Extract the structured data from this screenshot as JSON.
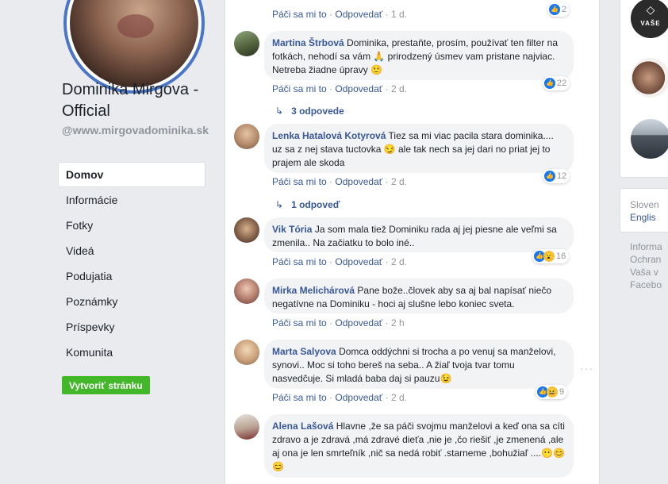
{
  "page": {
    "name": "Dominika Mirgova - Official",
    "handle": "@www.mirgovadominika.sk"
  },
  "nav": {
    "items": [
      "Domov",
      "Informácie",
      "Fotky",
      "Videá",
      "Podujatia",
      "Poznámky",
      "Príspevky",
      "Komunita"
    ],
    "create_button": "Vytvoriť stránku"
  },
  "labels": {
    "like": "Páči sa mi to",
    "reply": "Odpovedať",
    "dot": "·"
  },
  "top": {
    "time": "1 d.",
    "reactions": "2"
  },
  "comments": [
    {
      "author": "Martina Štrbová",
      "text": "Dominika, prestaňte, prosím, používať ten filter na fotkách, nehodí sa vám 🙏 prirodzený úsmev vam pristane najviac. Netreba žiadne úpravy 🙂",
      "time": "2 d.",
      "reactions": "22",
      "replies": "3 odpovede"
    },
    {
      "author": "Lenka Hatalová Kotyrová",
      "text": "Tiez sa mi viac pacila stara dominika.... uz sa z nej stava tuctovka 😏 ale tak nech sa jej dari no priat jej to prajem ale skoda",
      "time": "2 d.",
      "reactions": "12",
      "replies": "1 odpoveď"
    },
    {
      "author": "Vik Tória",
      "text": "Ja som mala tiež Dominiku rada aj jej piesne ale veľmi sa zmenila.. Na začiatku to bolo iné..",
      "time": "2 d.",
      "reactions": "16"
    },
    {
      "author": "Mirka Melichárová",
      "text": "Pane bože..človek aby sa aj bal napísať niečo negatívne na Dominiku - hoci aj slušne lebo koniec sveta.",
      "time": "2 h"
    },
    {
      "author": "Marta Salyova",
      "text": "Domca oddýchni si trocha a po venuj sa manželovi, synovi.. Moc si toho bereš na seba.. A žiaľ tvoja tvar tomu nasvedčuje. Si mladá baba daj si pauzu😉",
      "time": "2 d.",
      "reactions": "9"
    },
    {
      "author": "Alena Lašová",
      "text": "Hlavne ,že sa páči svojmu manželovi a keď ona sa cíti zdravo a je zdravá ,má zdravé dieťa ,nie je ,čo riešiť ,je zmenená ,ale aj ona je len smrteľník ,nič sa nedá robiť .starneme ,bohužiaľ ....😶😊😊"
    }
  ],
  "right": {
    "brand": "VAŠE",
    "lang_current": "Sloven",
    "lang_alt": "Englis",
    "footer": [
      "Informa",
      "Ochran",
      "Vaša v",
      "Facebo"
    ]
  }
}
